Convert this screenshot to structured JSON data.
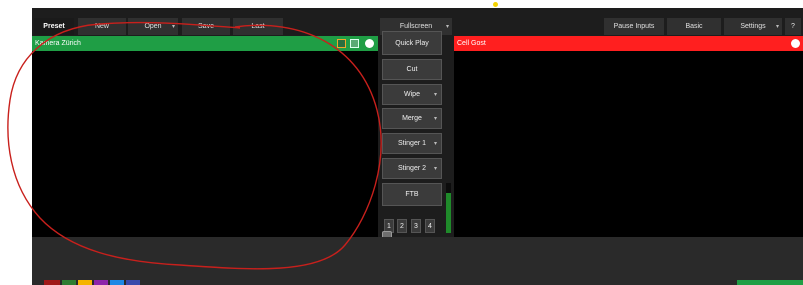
{
  "toolbar": {
    "preset_label": "Preset",
    "new_label": "New",
    "open_label": "Open",
    "save_label": "Save",
    "last_label": "Last",
    "fullscreen_label": "Fullscreen",
    "pause_inputs_label": "Pause Inputs",
    "basic_label": "Basic",
    "settings_label": "Settings",
    "help_label": "?"
  },
  "preview": {
    "title": "Kamera Zürich",
    "title_color": "#1f9e45"
  },
  "output": {
    "title": "Cell Gost",
    "title_color": "#ff1f1f"
  },
  "transitions": {
    "quick_play_label": "Quick Play",
    "cut_label": "Cut",
    "wipe_label": "Wipe",
    "merge_label": "Merge",
    "stinger1_label": "Stinger 1",
    "stinger2_label": "Stinger 2",
    "ftb_label": "FTB",
    "numbers": [
      "1",
      "2",
      "3",
      "4"
    ]
  },
  "colors": {
    "accent": "#1e7ad6",
    "annotation": "#c8201c",
    "swatches": [
      "#a01818",
      "#2e7d32",
      "#f5b400",
      "#8e24aa",
      "#1e88e5",
      "#3949ab"
    ]
  },
  "icons": {
    "dropdown": "chevron-down-icon",
    "close": "close-icon",
    "cut_mode": "layout-icon"
  }
}
